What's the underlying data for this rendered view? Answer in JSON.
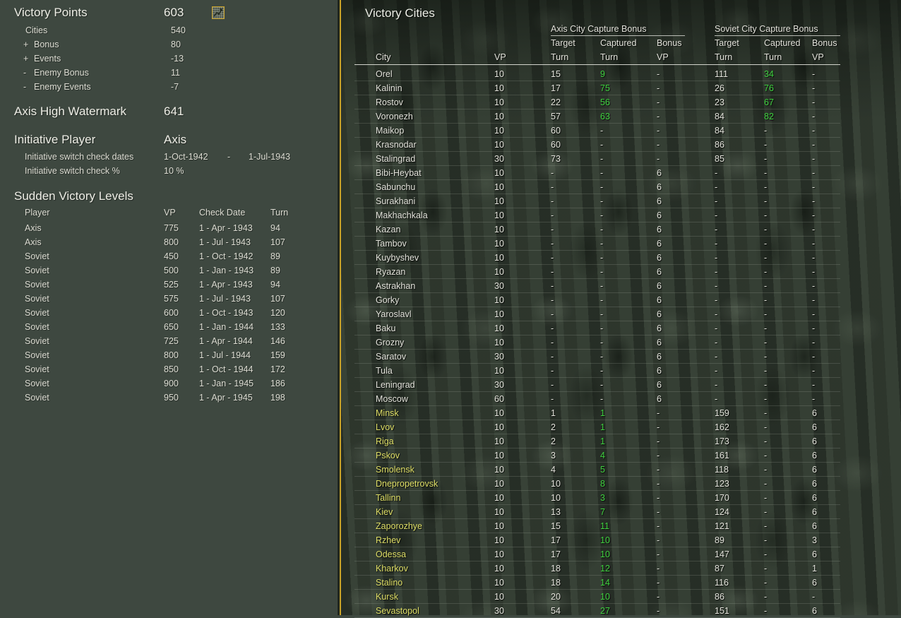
{
  "colors": {
    "gold": "#c9a227",
    "green": "#3fd03f",
    "yellow": "#dede66"
  },
  "left_panel": {
    "victory_points": {
      "label": "Victory Points",
      "value": "603"
    },
    "vp_breakdown": [
      {
        "rowClass": "noprefix",
        "prefix": "",
        "label": "Cities",
        "value": "540"
      },
      {
        "prefix": "+",
        "label": "Bonus",
        "value": "80"
      },
      {
        "prefix": "+",
        "label": "Events",
        "value": "-13"
      },
      {
        "prefix": "-",
        "label": "Enemy Bonus",
        "value": "11"
      },
      {
        "prefix": "-",
        "label": "Enemy Events",
        "value": "-7"
      }
    ],
    "axis_high_watermark": {
      "label": "Axis High Watermark",
      "value": "641"
    },
    "initiative": {
      "label": "Initiative Player",
      "value": "Axis",
      "rows": [
        {
          "label": "Initiative switch check dates",
          "v1": "1-Oct-1942",
          "sep": "-",
          "v2": "1-Jul-1943"
        },
        {
          "label": "Initiative switch check %",
          "v1": "10 %",
          "sep": "",
          "v2": ""
        }
      ]
    },
    "sudden_victory": {
      "title": "Sudden Victory Levels",
      "columns": {
        "player": "Player",
        "vp": "VP",
        "date": "Check Date",
        "turn": "Turn"
      },
      "rows": [
        {
          "player": "Axis",
          "vp": "775",
          "date": "1 - Apr - 1943",
          "turn": "94"
        },
        {
          "player": "Axis",
          "vp": "800",
          "date": "1 - Jul - 1943",
          "turn": "107"
        },
        {
          "player": "Soviet",
          "vp": "450",
          "date": "1 - Oct - 1942",
          "turn": "89"
        },
        {
          "player": "Soviet",
          "vp": "500",
          "date": "1 - Jan - 1943",
          "turn": "89"
        },
        {
          "player": "Soviet",
          "vp": "525",
          "date": "1 - Apr - 1943",
          "turn": "94"
        },
        {
          "player": "Soviet",
          "vp": "575",
          "date": "1 - Jul - 1943",
          "turn": "107"
        },
        {
          "player": "Soviet",
          "vp": "600",
          "date": "1 - Oct - 1943",
          "turn": "120"
        },
        {
          "player": "Soviet",
          "vp": "650",
          "date": "1 - Jan - 1944",
          "turn": "133"
        },
        {
          "player": "Soviet",
          "vp": "725",
          "date": "1 - Apr - 1944",
          "turn": "146"
        },
        {
          "player": "Soviet",
          "vp": "800",
          "date": "1 - Jul - 1944",
          "turn": "159"
        },
        {
          "player": "Soviet",
          "vp": "850",
          "date": "1 - Oct - 1944",
          "turn": "172"
        },
        {
          "player": "Soviet",
          "vp": "900",
          "date": "1 - Jan - 1945",
          "turn": "186"
        },
        {
          "player": "Soviet",
          "vp": "950",
          "date": "1 - Apr - 1945",
          "turn": "198"
        }
      ]
    }
  },
  "right_panel": {
    "title": "Victory Cities",
    "axis_group": "Axis City Capture Bonus",
    "soviet_group": "Soviet City Capture Bonus",
    "columns": {
      "city": "City",
      "vp": "VP",
      "target": "Target",
      "captured": "Captured",
      "bonus": "Bonus",
      "turn": "Turn",
      "vp2": "VP"
    },
    "rows": [
      {
        "city": "Orel",
        "vp": "10",
        "at": "15",
        "ac": "9",
        "acClass": "captured",
        "ab": "-",
        "st": "111",
        "sc": "34",
        "scClass": "captured",
        "sb": "-"
      },
      {
        "city": "Kalinin",
        "vp": "10",
        "at": "17",
        "ac": "75",
        "acClass": "captured",
        "ab": "-",
        "st": "26",
        "sc": "76",
        "scClass": "captured",
        "sb": "-"
      },
      {
        "city": "Rostov",
        "vp": "10",
        "at": "22",
        "ac": "56",
        "acClass": "captured",
        "ab": "-",
        "st": "23",
        "sc": "67",
        "scClass": "captured",
        "sb": "-"
      },
      {
        "city": "Voronezh",
        "vp": "10",
        "at": "57",
        "ac": "63",
        "acClass": "captured",
        "ab": "-",
        "st": "84",
        "sc": "82",
        "scClass": "captured",
        "sb": "-"
      },
      {
        "city": "Maikop",
        "vp": "10",
        "at": "60",
        "ac": "-",
        "ab": "-",
        "st": "84",
        "sc": "-",
        "sb": "-"
      },
      {
        "city": "Krasnodar",
        "vp": "10",
        "at": "60",
        "ac": "-",
        "ab": "-",
        "st": "86",
        "sc": "-",
        "sb": "-"
      },
      {
        "city": "Stalingrad",
        "vp": "30",
        "at": "73",
        "ac": "-",
        "ab": "-",
        "st": "85",
        "sc": "-",
        "sb": "-"
      },
      {
        "city": "Bibi-Heybat",
        "vp": "10",
        "at": "-",
        "ac": "-",
        "ab": "6",
        "st": "-",
        "sc": "-",
        "sb": "-"
      },
      {
        "city": "Sabunchu",
        "vp": "10",
        "at": "-",
        "ac": "-",
        "ab": "6",
        "st": "-",
        "sc": "-",
        "sb": "-"
      },
      {
        "city": "Surakhani",
        "vp": "10",
        "at": "-",
        "ac": "-",
        "ab": "6",
        "st": "-",
        "sc": "-",
        "sb": "-"
      },
      {
        "city": "Makhachkala",
        "vp": "10",
        "at": "-",
        "ac": "-",
        "ab": "6",
        "st": "-",
        "sc": "-",
        "sb": "-"
      },
      {
        "city": "Kazan",
        "vp": "10",
        "at": "-",
        "ac": "-",
        "ab": "6",
        "st": "-",
        "sc": "-",
        "sb": "-"
      },
      {
        "city": "Tambov",
        "vp": "10",
        "at": "-",
        "ac": "-",
        "ab": "6",
        "st": "-",
        "sc": "-",
        "sb": "-"
      },
      {
        "city": "Kuybyshev",
        "vp": "10",
        "at": "-",
        "ac": "-",
        "ab": "6",
        "st": "-",
        "sc": "-",
        "sb": "-"
      },
      {
        "city": "Ryazan",
        "vp": "10",
        "at": "-",
        "ac": "-",
        "ab": "6",
        "st": "-",
        "sc": "-",
        "sb": "-"
      },
      {
        "city": "Astrakhan",
        "vp": "30",
        "at": "-",
        "ac": "-",
        "ab": "6",
        "st": "-",
        "sc": "-",
        "sb": "-"
      },
      {
        "city": "Gorky",
        "vp": "10",
        "at": "-",
        "ac": "-",
        "ab": "6",
        "st": "-",
        "sc": "-",
        "sb": "-"
      },
      {
        "city": "Yaroslavl",
        "vp": "10",
        "at": "-",
        "ac": "-",
        "ab": "6",
        "st": "-",
        "sc": "-",
        "sb": "-"
      },
      {
        "city": "Baku",
        "vp": "10",
        "at": "-",
        "ac": "-",
        "ab": "6",
        "st": "-",
        "sc": "-",
        "sb": "-"
      },
      {
        "city": "Grozny",
        "vp": "10",
        "at": "-",
        "ac": "-",
        "ab": "6",
        "st": "-",
        "sc": "-",
        "sb": "-"
      },
      {
        "city": "Saratov",
        "vp": "30",
        "at": "-",
        "ac": "-",
        "ab": "6",
        "st": "-",
        "sc": "-",
        "sb": "-"
      },
      {
        "city": "Tula",
        "vp": "10",
        "at": "-",
        "ac": "-",
        "ab": "6",
        "st": "-",
        "sc": "-",
        "sb": "-"
      },
      {
        "city": "Leningrad",
        "vp": "30",
        "at": "-",
        "ac": "-",
        "ab": "6",
        "st": "-",
        "sc": "-",
        "sb": "-"
      },
      {
        "city": "Moscow",
        "vp": "60",
        "at": "-",
        "ac": "-",
        "ab": "6",
        "st": "-",
        "sc": "-",
        "sb": "-"
      },
      {
        "city": "Minsk",
        "cityClass": "axis-held",
        "vp": "10",
        "at": "1",
        "ac": "1",
        "acClass": "captured",
        "ab": "-",
        "st": "159",
        "sc": "-",
        "sb": "6"
      },
      {
        "city": "Lvov",
        "cityClass": "axis-held",
        "vp": "10",
        "at": "2",
        "ac": "1",
        "acClass": "captured",
        "ab": "-",
        "st": "162",
        "sc": "-",
        "sb": "6"
      },
      {
        "city": "Riga",
        "cityClass": "axis-held",
        "vp": "10",
        "at": "2",
        "ac": "1",
        "acClass": "captured",
        "ab": "-",
        "st": "173",
        "sc": "-",
        "sb": "6"
      },
      {
        "city": "Pskov",
        "cityClass": "axis-held",
        "vp": "10",
        "at": "3",
        "ac": "4",
        "acClass": "captured",
        "ab": "-",
        "st": "161",
        "sc": "-",
        "sb": "6"
      },
      {
        "city": "Smolensk",
        "cityClass": "axis-held",
        "vp": "10",
        "at": "4",
        "ac": "5",
        "acClass": "captured",
        "ab": "-",
        "st": "118",
        "sc": "-",
        "sb": "6"
      },
      {
        "city": "Dnepropetrovsk",
        "cityClass": "axis-held",
        "vp": "10",
        "at": "10",
        "ac": "8",
        "acClass": "captured",
        "ab": "-",
        "st": "123",
        "sc": "-",
        "sb": "6"
      },
      {
        "city": "Tallinn",
        "cityClass": "axis-held",
        "vp": "10",
        "at": "10",
        "ac": "3",
        "acClass": "captured",
        "ab": "-",
        "st": "170",
        "sc": "-",
        "sb": "6"
      },
      {
        "city": "Kiev",
        "cityClass": "axis-held",
        "vp": "10",
        "at": "13",
        "ac": "7",
        "acClass": "captured",
        "ab": "-",
        "st": "124",
        "sc": "-",
        "sb": "6"
      },
      {
        "city": "Zaporozhye",
        "cityClass": "axis-held",
        "vp": "10",
        "at": "15",
        "ac": "11",
        "acClass": "captured",
        "ab": "-",
        "st": "121",
        "sc": "-",
        "sb": "6"
      },
      {
        "city": "Rzhev",
        "cityClass": "axis-held",
        "vp": "10",
        "at": "17",
        "ac": "10",
        "acClass": "captured",
        "ab": "-",
        "st": "89",
        "sc": "-",
        "sb": "3"
      },
      {
        "city": "Odessa",
        "cityClass": "axis-held",
        "vp": "10",
        "at": "17",
        "ac": "10",
        "acClass": "captured",
        "ab": "-",
        "st": "147",
        "sc": "-",
        "sb": "6"
      },
      {
        "city": "Kharkov",
        "cityClass": "axis-held",
        "vp": "10",
        "at": "18",
        "ac": "12",
        "acClass": "captured",
        "ab": "-",
        "st": "87",
        "sc": "-",
        "sb": "1"
      },
      {
        "city": "Stalino",
        "cityClass": "axis-held",
        "vp": "10",
        "at": "18",
        "ac": "14",
        "acClass": "captured",
        "ab": "-",
        "st": "116",
        "sc": "-",
        "sb": "6"
      },
      {
        "city": "Kursk",
        "cityClass": "axis-held",
        "vp": "10",
        "at": "20",
        "ac": "10",
        "acClass": "captured",
        "ab": "-",
        "st": "86",
        "sc": "-",
        "sb": "-"
      },
      {
        "city": "Sevastopol",
        "cityClass": "axis-held",
        "vp": "30",
        "at": "54",
        "ac": "27",
        "acClass": "captured",
        "ab": "-",
        "st": "151",
        "sc": "-",
        "sb": "6"
      }
    ]
  }
}
